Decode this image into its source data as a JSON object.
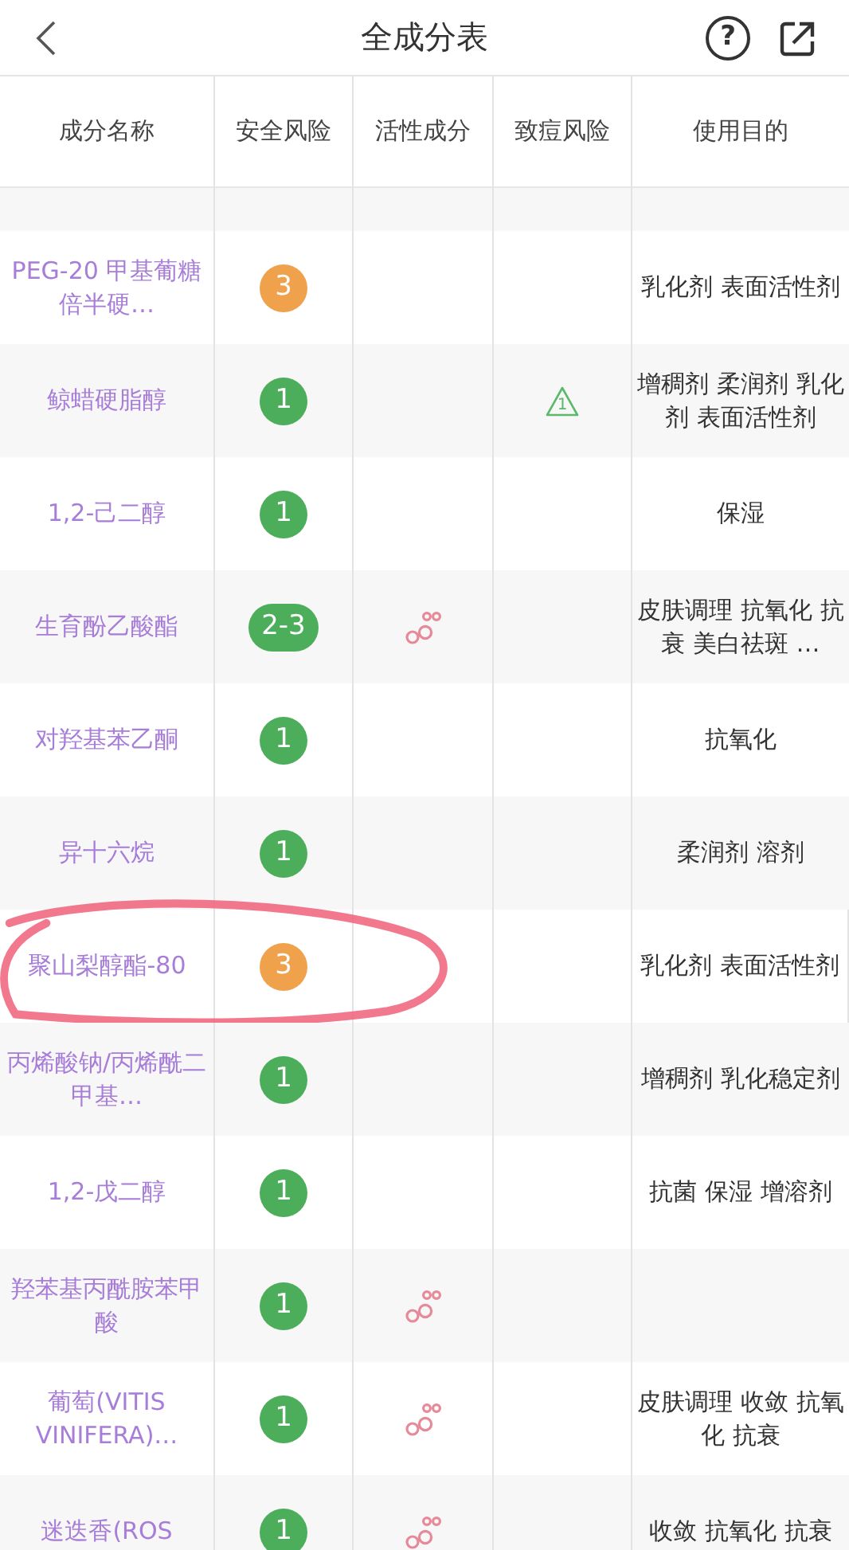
{
  "header": {
    "title": "全成分表",
    "help_glyph": "?"
  },
  "table": {
    "columns": [
      "成分名称",
      "安全风险",
      "活性成分",
      "致痘风险",
      "使用目的"
    ],
    "rows": [
      {
        "name": "PEG-20 甲基葡糖倍半硬…",
        "color": "#f0a14c",
        "risk": "3",
        "active": false,
        "acne": "",
        "purpose": "乳化剂 表面活性剂",
        "circled": false
      },
      {
        "name": "鲸蜡硬脂醇",
        "color": "#4cae5b",
        "risk": "1",
        "active": false,
        "acne": "1",
        "purpose": "增稠剂 柔润剂 乳化剂 表面活性剂",
        "circled": false
      },
      {
        "name": "1,2-己二醇",
        "color": "#4cae5b",
        "risk": "1",
        "active": false,
        "acne": "",
        "purpose": "保湿",
        "circled": false
      },
      {
        "name": "生育酚乙酸酯",
        "color": "#4cae5b",
        "risk": "2-3",
        "active": true,
        "acne": "",
        "purpose": "皮肤调理 抗氧化 抗衰 美白祛斑 …",
        "circled": false
      },
      {
        "name": "对羟基苯乙酮",
        "color": "#4cae5b",
        "risk": "1",
        "active": false,
        "acne": "",
        "purpose": "抗氧化",
        "circled": false
      },
      {
        "name": "异十六烷",
        "color": "#4cae5b",
        "risk": "1",
        "active": false,
        "acne": "",
        "purpose": "柔润剂 溶剂",
        "circled": false
      },
      {
        "name": "聚山梨醇酯-80",
        "color": "#f0a14c",
        "risk": "3",
        "active": false,
        "acne": "",
        "purpose": "乳化剂 表面活性剂",
        "circled": true
      },
      {
        "name": "丙烯酸钠/丙烯酰二甲基…",
        "color": "#4cae5b",
        "risk": "1",
        "active": false,
        "acne": "",
        "purpose": "增稠剂 乳化稳定剂",
        "circled": false
      },
      {
        "name": "1,2-戊二醇",
        "color": "#4cae5b",
        "risk": "1",
        "active": false,
        "acne": "",
        "purpose": "抗菌 保湿 增溶剂",
        "circled": false
      },
      {
        "name": "羟苯基丙酰胺苯甲酸",
        "color": "#4cae5b",
        "risk": "1",
        "active": true,
        "acne": "",
        "purpose": "",
        "circled": false
      },
      {
        "name": "葡萄(VITIS VINIFERA)…",
        "color": "#4cae5b",
        "risk": "1",
        "active": true,
        "acne": "",
        "purpose": "皮肤调理 收敛 抗氧化 抗衰",
        "circled": false
      },
      {
        "name": "迷迭香(ROS",
        "color": "#4cae5b",
        "risk": "1",
        "active": true,
        "acne": "",
        "purpose": "收敛 抗氧化 抗衰",
        "circled": false
      }
    ]
  }
}
